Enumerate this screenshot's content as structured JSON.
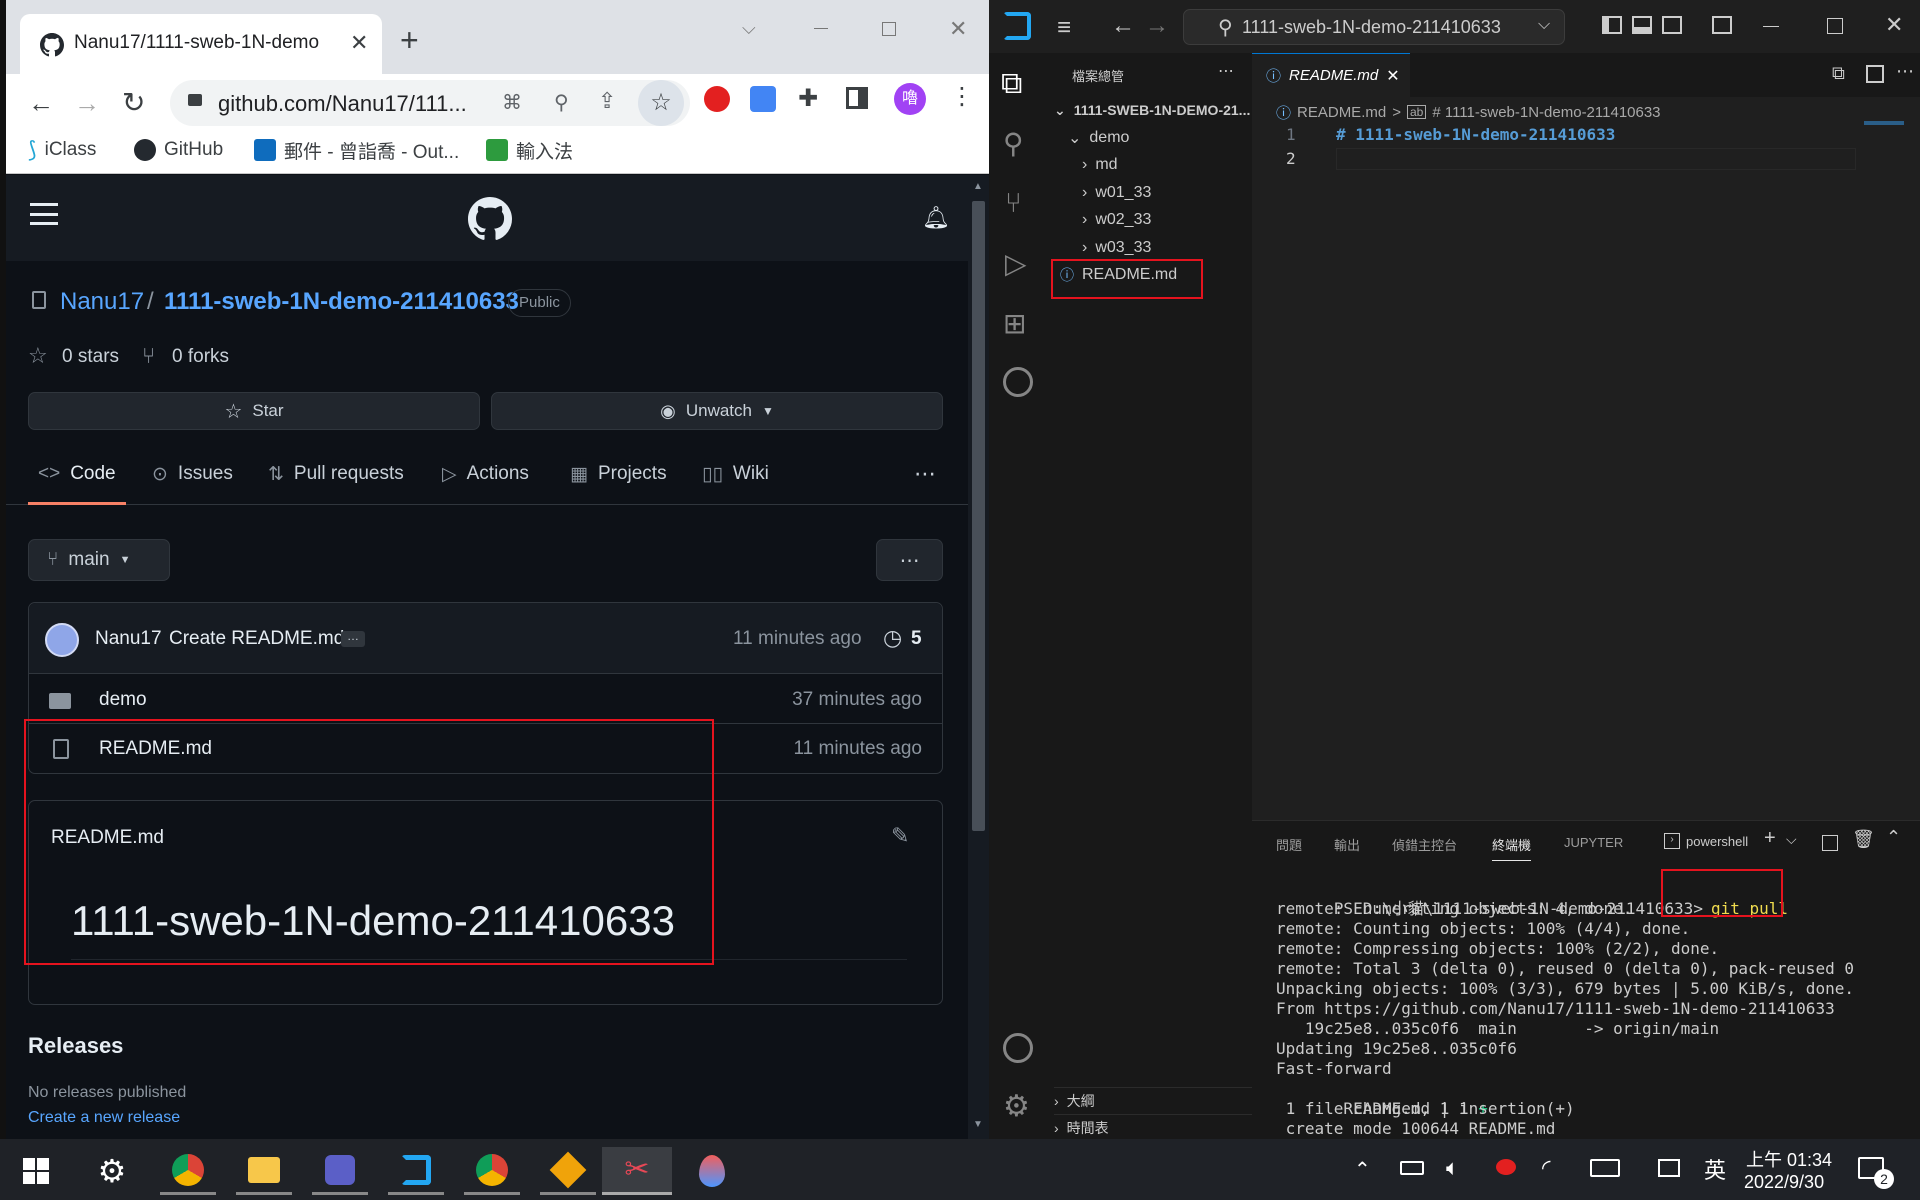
{
  "browser": {
    "tab_title": "Nanu17/1111-sweb-1N-demo",
    "url": "github.com/Nanu17/111...",
    "profile_initial": "嚕",
    "bookmarks": [
      "iClass",
      "GitHub",
      "郵件 - 曾詣喬 - Out...",
      "輸入法"
    ]
  },
  "github": {
    "owner": "Nanu17",
    "sep": "/",
    "repo": "1111-sweb-1N-demo-211410633",
    "visibility": "Public",
    "stars": "0 stars",
    "forks": "0 forks",
    "star_label": "Star",
    "unwatch_label": "Unwatch",
    "tabs": [
      "Code",
      "Issues",
      "Pull requests",
      "Actions",
      "Projects",
      "Wiki"
    ],
    "branch": "main",
    "commit_author": "Nanu17",
    "commit_msg": "Create README.md",
    "commit_time": "11 minutes ago",
    "commit_count": "5",
    "files": [
      {
        "name": "demo",
        "time": "37 minutes ago",
        "type": "folder"
      },
      {
        "name": "README.md",
        "time": "11 minutes ago",
        "type": "file"
      }
    ],
    "readme_title": "README.md",
    "readme_heading": "1111-sweb-1N-demo-211410633",
    "releases_title": "Releases",
    "releases_none": "No releases published",
    "releases_link": "Create a new release"
  },
  "vscode": {
    "search": "1111-sweb-1N-demo-211410633",
    "explorer_title": "檔案總管",
    "root": "1111-SWEB-1N-DEMO-21...",
    "tree": [
      "demo",
      "md",
      "w01_33",
      "w02_33",
      "w03_33",
      "README.md"
    ],
    "editor_tab": "README.md",
    "breadcrumb_file": "README.md",
    "breadcrumb_sep": ">",
    "breadcrumb_symbol": "# 1111-sweb-1N-demo-211410633",
    "line_numbers": [
      "1",
      "2"
    ],
    "line1": "# 1111-sweb-1N-demo-211410633",
    "outline": "大綱",
    "timeline": "時間表",
    "panel_tabs": [
      "問題",
      "輸出",
      "偵錯主控台",
      "終端機",
      "JUPYTER"
    ],
    "terminal_type": "powershell",
    "terminal_prompt": "PS D:\\小貓\\1111-sweb-1N-demo-211410633>",
    "terminal_cmd": "git pull",
    "terminal_lines": [
      "remote: Enumerating objects: 4, done.",
      "remote: Counting objects: 100% (4/4), done.",
      "remote: Compressing objects: 100% (2/2), done.",
      "remote: Total 3 (delta 0), reused 0 (delta 0), pack-reused 0",
      "Unpacking objects: 100% (3/3), 679 bytes | 5.00 KiB/s, done.",
      "From https://github.com/Nanu17/1111-sweb-1N-demo-211410633",
      "   19c25e8..035c0f6  main       -> origin/main",
      "Updating 19c25e8..035c0f6",
      "Fast-forward",
      " README.md | 1 ",
      " 1 file changed, 1 insertion(+)",
      " create mode 100644 README.md"
    ],
    "diff_plus": "+"
  },
  "taskbar": {
    "ime": "英",
    "time": "上午 01:34",
    "date": "2022/9/30",
    "notif_count": "2"
  }
}
